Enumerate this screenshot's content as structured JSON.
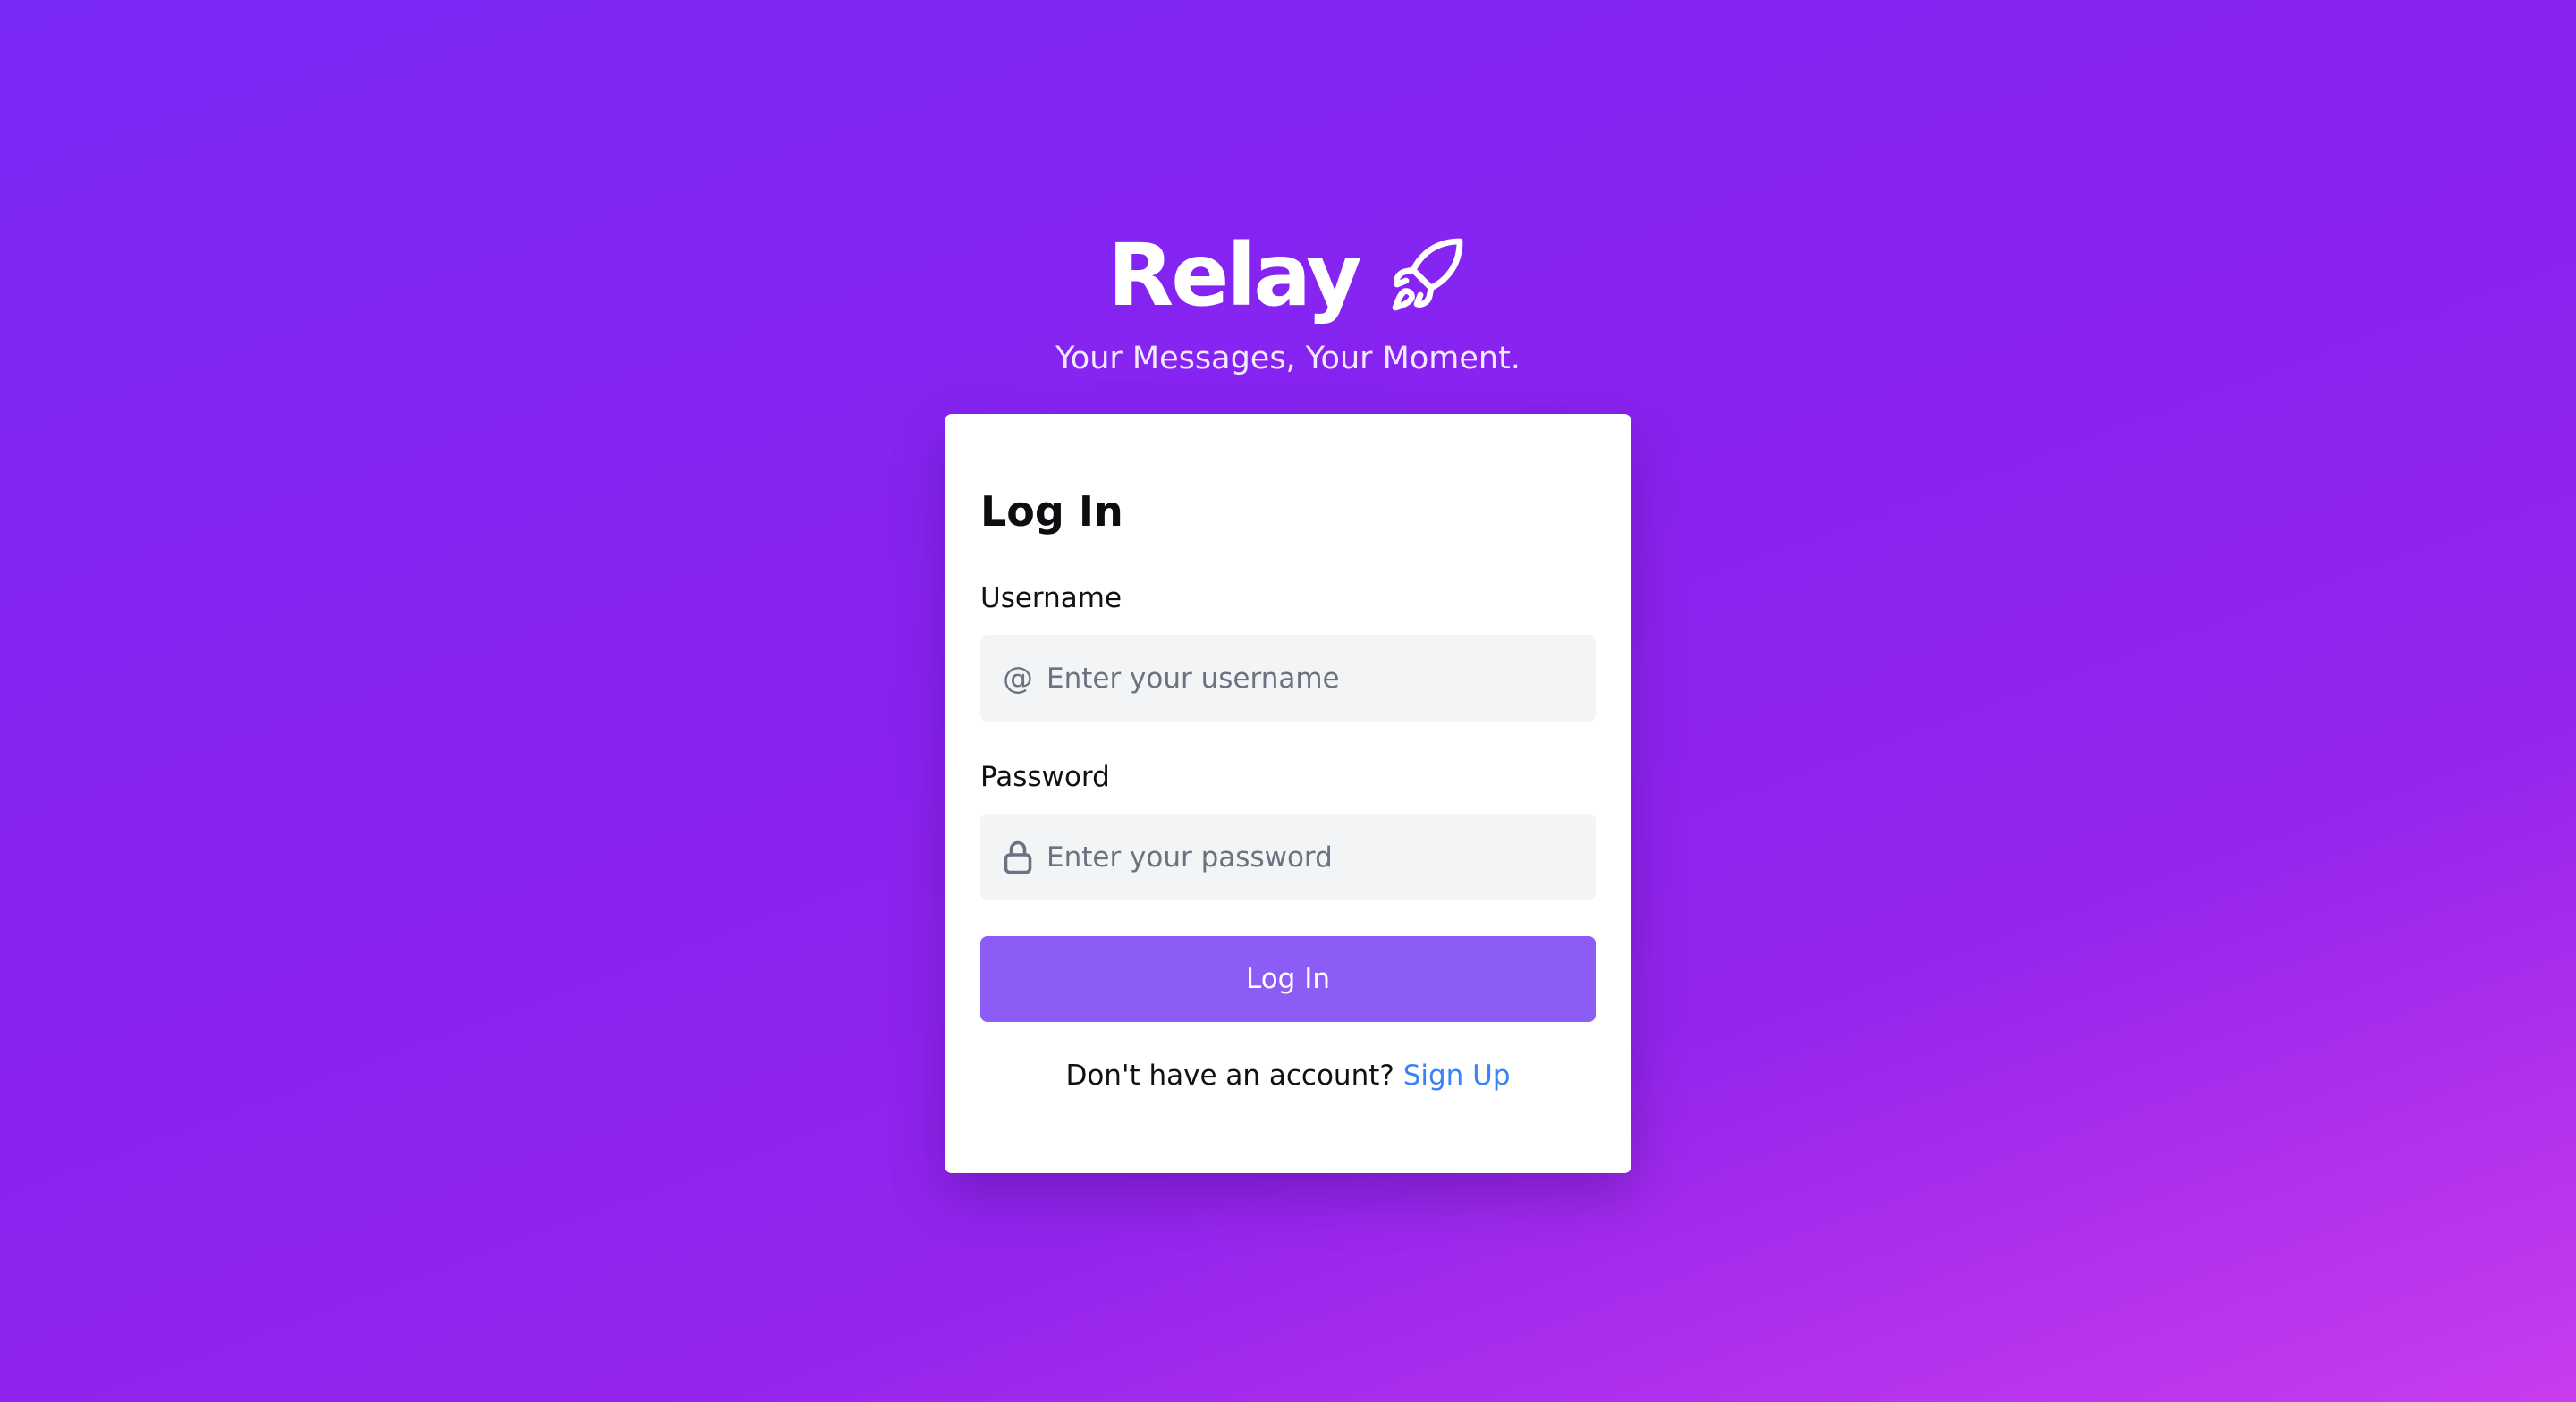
{
  "brand": {
    "name": "Relay",
    "icon": "rocket-icon",
    "tagline": "Your Messages, Your Moment."
  },
  "login_card": {
    "title": "Log In",
    "username": {
      "label": "Username",
      "icon": "at-icon",
      "icon_glyph": "@",
      "placeholder": "Enter your username",
      "value": ""
    },
    "password": {
      "label": "Password",
      "icon": "lock-icon",
      "placeholder": "Enter your password",
      "value": ""
    },
    "submit_label": "Log In",
    "signup_prompt": "Don't have an account?",
    "signup_link": "Sign Up"
  },
  "colors": {
    "background_start": "#7a28f6",
    "background_end": "#c93cee",
    "button": "#8b5cf6",
    "link": "#3b82f6",
    "input_bg": "#f3f4f6"
  }
}
